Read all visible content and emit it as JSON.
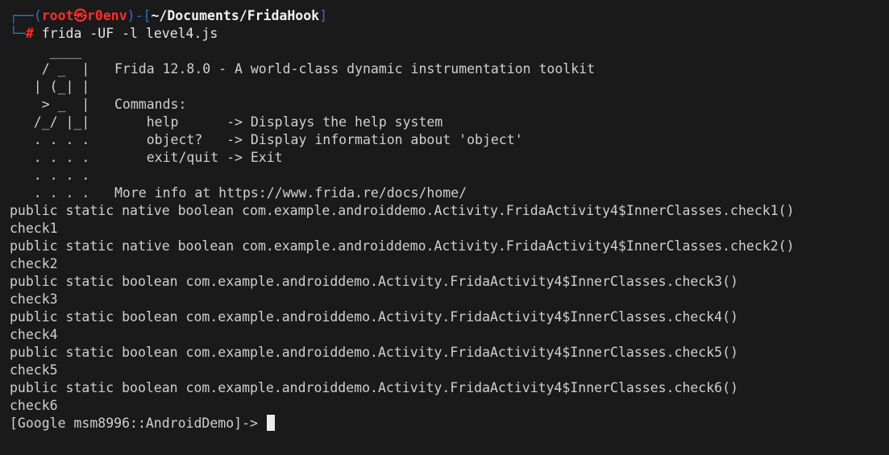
{
  "prompt": {
    "corner_top": "┌──",
    "corner_bottom": "└─",
    "user": "root",
    "at_symbol": "㉿",
    "host": "r0env",
    "path": "~/Documents/FridaHook",
    "hash": "#",
    "command": " frida -UF -l level4.js"
  },
  "banner": {
    "art": [
      "     ____",
      "    / _  |",
      "   | (_| |",
      "    > _  |",
      "   /_/ |_|",
      "   . . . .",
      "   . . . .",
      "   . . . .",
      "   . . . ."
    ],
    "text": [
      "",
      "Frida 12.8.0 - A world-class dynamic instrumentation toolkit",
      "",
      "Commands:",
      "    help      -> Displays the help system",
      "    object?   -> Display information about 'object'",
      "    exit/quit -> Exit",
      "",
      "More info at https://www.frida.re/docs/home/"
    ]
  },
  "output": [
    "public static native boolean com.example.androiddemo.Activity.FridaActivity4$InnerClasses.check1()",
    "check1",
    "public static native boolean com.example.androiddemo.Activity.FridaActivity4$InnerClasses.check2()",
    "check2",
    "public static boolean com.example.androiddemo.Activity.FridaActivity4$InnerClasses.check3()",
    "check3",
    "public static boolean com.example.androiddemo.Activity.FridaActivity4$InnerClasses.check4()",
    "check4",
    "public static boolean com.example.androiddemo.Activity.FridaActivity4$InnerClasses.check5()",
    "check5",
    "public static boolean com.example.androiddemo.Activity.FridaActivity4$InnerClasses.check6()",
    "check6"
  ],
  "repl_prompt": "[Google msm8996::AndroidDemo]-> ",
  "colors": {
    "background": "#1a1a1a",
    "foreground": "#d0d0d0",
    "prompt_frame": "#2f6fd6",
    "prompt_user": "#ff2c2c",
    "path": "#f2f2f2"
  }
}
